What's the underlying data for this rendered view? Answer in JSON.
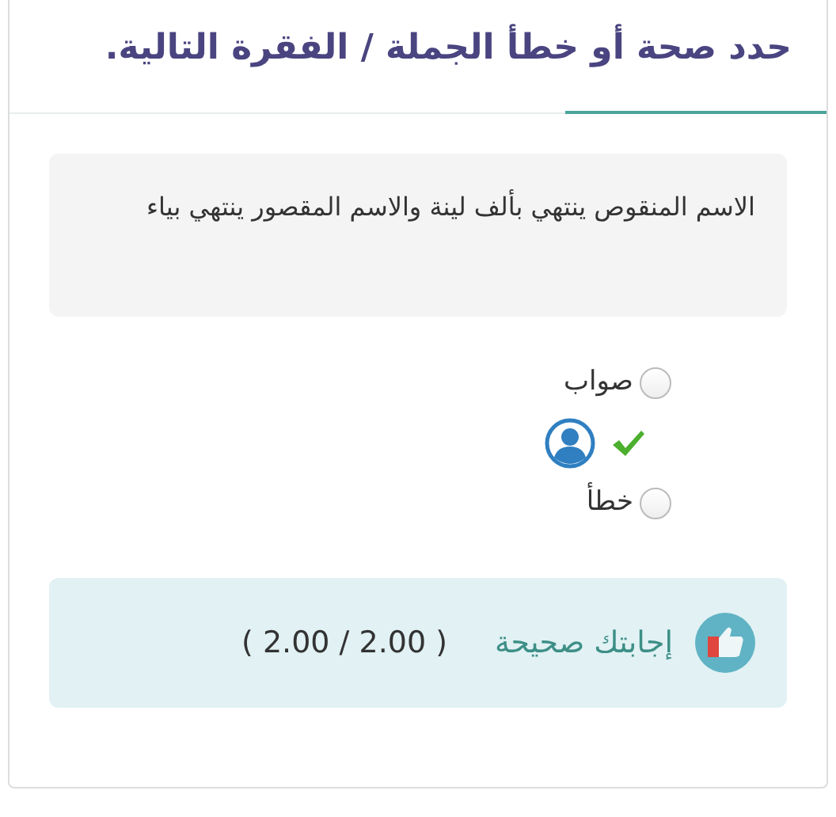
{
  "question": {
    "title": "حدد صحة أو خطأ الجملة / الفقرة التالية.",
    "statement": "الاسم المنقوص ينتهي بألف لينة  والاسم المقصور ينتهي بياء"
  },
  "options": [
    {
      "label": "صواب",
      "selected": false,
      "marked_correct": true
    },
    {
      "label": "خطأ",
      "selected": false,
      "marked_correct": false
    }
  ],
  "feedback": {
    "message": "إجابتك صحيحة",
    "score": "( 2.00 / 2.00 )"
  }
}
